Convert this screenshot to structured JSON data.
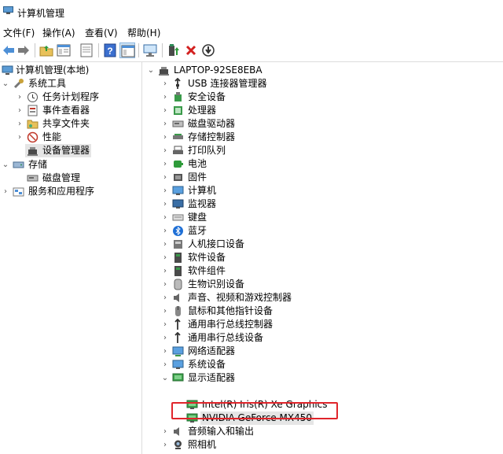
{
  "window": {
    "title": "计算机管理"
  },
  "menu": [
    {
      "label": "文件(F)"
    },
    {
      "label": "操作(A)"
    },
    {
      "label": "查看(V)"
    },
    {
      "label": "帮助(H)"
    }
  ],
  "toolbar": {
    "icons": [
      "back-arrow-icon",
      "forward-arrow-icon",
      "folder-up-icon",
      "properties-icon",
      "export-list-icon",
      "help-icon",
      "show-pane-icon",
      "monitor-icon",
      "update-driver-icon",
      "uninstall-x-icon",
      "scan-download-icon"
    ]
  },
  "left_tree": {
    "root": "计算机管理(本地)",
    "system_tools": "系统工具",
    "task_scheduler": "任务计划程序",
    "event_viewer": "事件查看器",
    "shared_folders": "共享文件夹",
    "performance": "性能",
    "device_manager": "设备管理器",
    "storage": "存储",
    "disk_management": "磁盘管理",
    "services_apps": "服务和应用程序"
  },
  "right_tree": {
    "root": "LAPTOP-92SE8EBA",
    "categories": [
      "USB 连接器管理器",
      "安全设备",
      "处理器",
      "磁盘驱动器",
      "存储控制器",
      "打印队列",
      "电池",
      "固件",
      "计算机",
      "监视器",
      "键盘",
      "蓝牙",
      "人机接口设备",
      "软件设备",
      "软件组件",
      "生物识别设备",
      "声音、视频和游戏控制器",
      "鼠标和其他指针设备",
      "通用串行总线控制器",
      "通用串行总线设备",
      "网络适配器",
      "系统设备",
      "显示适配器"
    ],
    "display_children": [
      "Intel(R) Iris(R) Xe Graphics",
      "NVIDIA GeForce MX450"
    ],
    "after": [
      "音频输入和输出",
      "照相机"
    ]
  },
  "colors": {
    "highlight": "#e0252b",
    "selected": "#e5e5e5"
  }
}
